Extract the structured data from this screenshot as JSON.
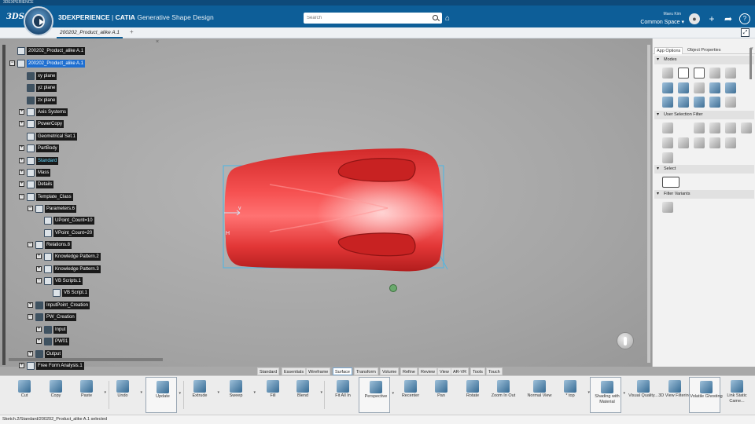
{
  "window": {
    "title": "3DEXPERIENCE"
  },
  "header": {
    "brand": "3DEXPERIENCE",
    "separator": " | ",
    "product": "CATIA",
    "app": "Generative Shape Design",
    "search_placeholder": "Search",
    "user": "Maeu Kim",
    "space": "Common Space"
  },
  "tabs": {
    "document": "200202_Product_alike A.1",
    "add": "+"
  },
  "tree": [
    {
      "label": "200202_Product_alike A.1"
    },
    {
      "label": "200202_Product_alike A.1"
    },
    {
      "label": "xy plane"
    },
    {
      "label": "yz plane"
    },
    {
      "label": "zx plane"
    },
    {
      "label": "Axis Systems"
    },
    {
      "label": "PowerCopy"
    },
    {
      "label": "Geometrical Set.1"
    },
    {
      "label": "PartBody"
    },
    {
      "label": "Standard"
    },
    {
      "label": "Mass"
    },
    {
      "label": "Details"
    },
    {
      "label": "Template_Class"
    },
    {
      "label": "Parameters.6"
    },
    {
      "label": "UPoint_Count=10"
    },
    {
      "label": "VPoint_Count=20"
    },
    {
      "label": "Relations.8"
    },
    {
      "label": "Knowledge Pattern.2"
    },
    {
      "label": "Knowledge Pattern.3"
    },
    {
      "label": "VB Scripts.1"
    },
    {
      "label": "VB Script.1"
    },
    {
      "label": "InputPoint_Creation"
    },
    {
      "label": "PW_Creation"
    },
    {
      "label": "Input"
    },
    {
      "label": "PW01"
    },
    {
      "label": "Output"
    },
    {
      "label": "Free Form Analysis.1"
    }
  ],
  "right_panel": {
    "tab_app": "App Options",
    "tab_obj": "Object Properties",
    "modes": "Modes",
    "user_selection_filter": "User Selection Filter",
    "select": "Select",
    "filter_variants": "Filter Variants"
  },
  "section_tabs": [
    "Standard",
    "Essentials",
    "Wireframe",
    "Surface",
    "Transform",
    "Volume",
    "Refine",
    "Review",
    "View",
    "AR-VR",
    "Tools",
    "Touch"
  ],
  "actions": [
    {
      "label": "Cut"
    },
    {
      "label": "Copy"
    },
    {
      "label": "Paste"
    },
    {
      "label": "Undo"
    },
    {
      "label": "Update"
    },
    {
      "label": "Extrude"
    },
    {
      "label": "Sweep"
    },
    {
      "label": "Fill"
    },
    {
      "label": "Blend"
    },
    {
      "label": "Fit All In"
    },
    {
      "label": "Perspective"
    },
    {
      "label": "Recenter"
    },
    {
      "label": "Pan"
    },
    {
      "label": "Rotate"
    },
    {
      "label": "Zoom In Out"
    },
    {
      "label": "Normal View"
    },
    {
      "label": "* top"
    },
    {
      "label": "Shading with Material"
    },
    {
      "label": "Visual Quality..."
    },
    {
      "label": "3D View Filtering"
    },
    {
      "label": "Volatile Ghosting"
    },
    {
      "label": "Link Static Came..."
    }
  ],
  "status": "Sketch.2/Standard/200202_Product_alike A.1 selected",
  "colors": {
    "accent": "#0d5e98",
    "part": "#e43a3a",
    "selection": "#1f6fd1"
  }
}
